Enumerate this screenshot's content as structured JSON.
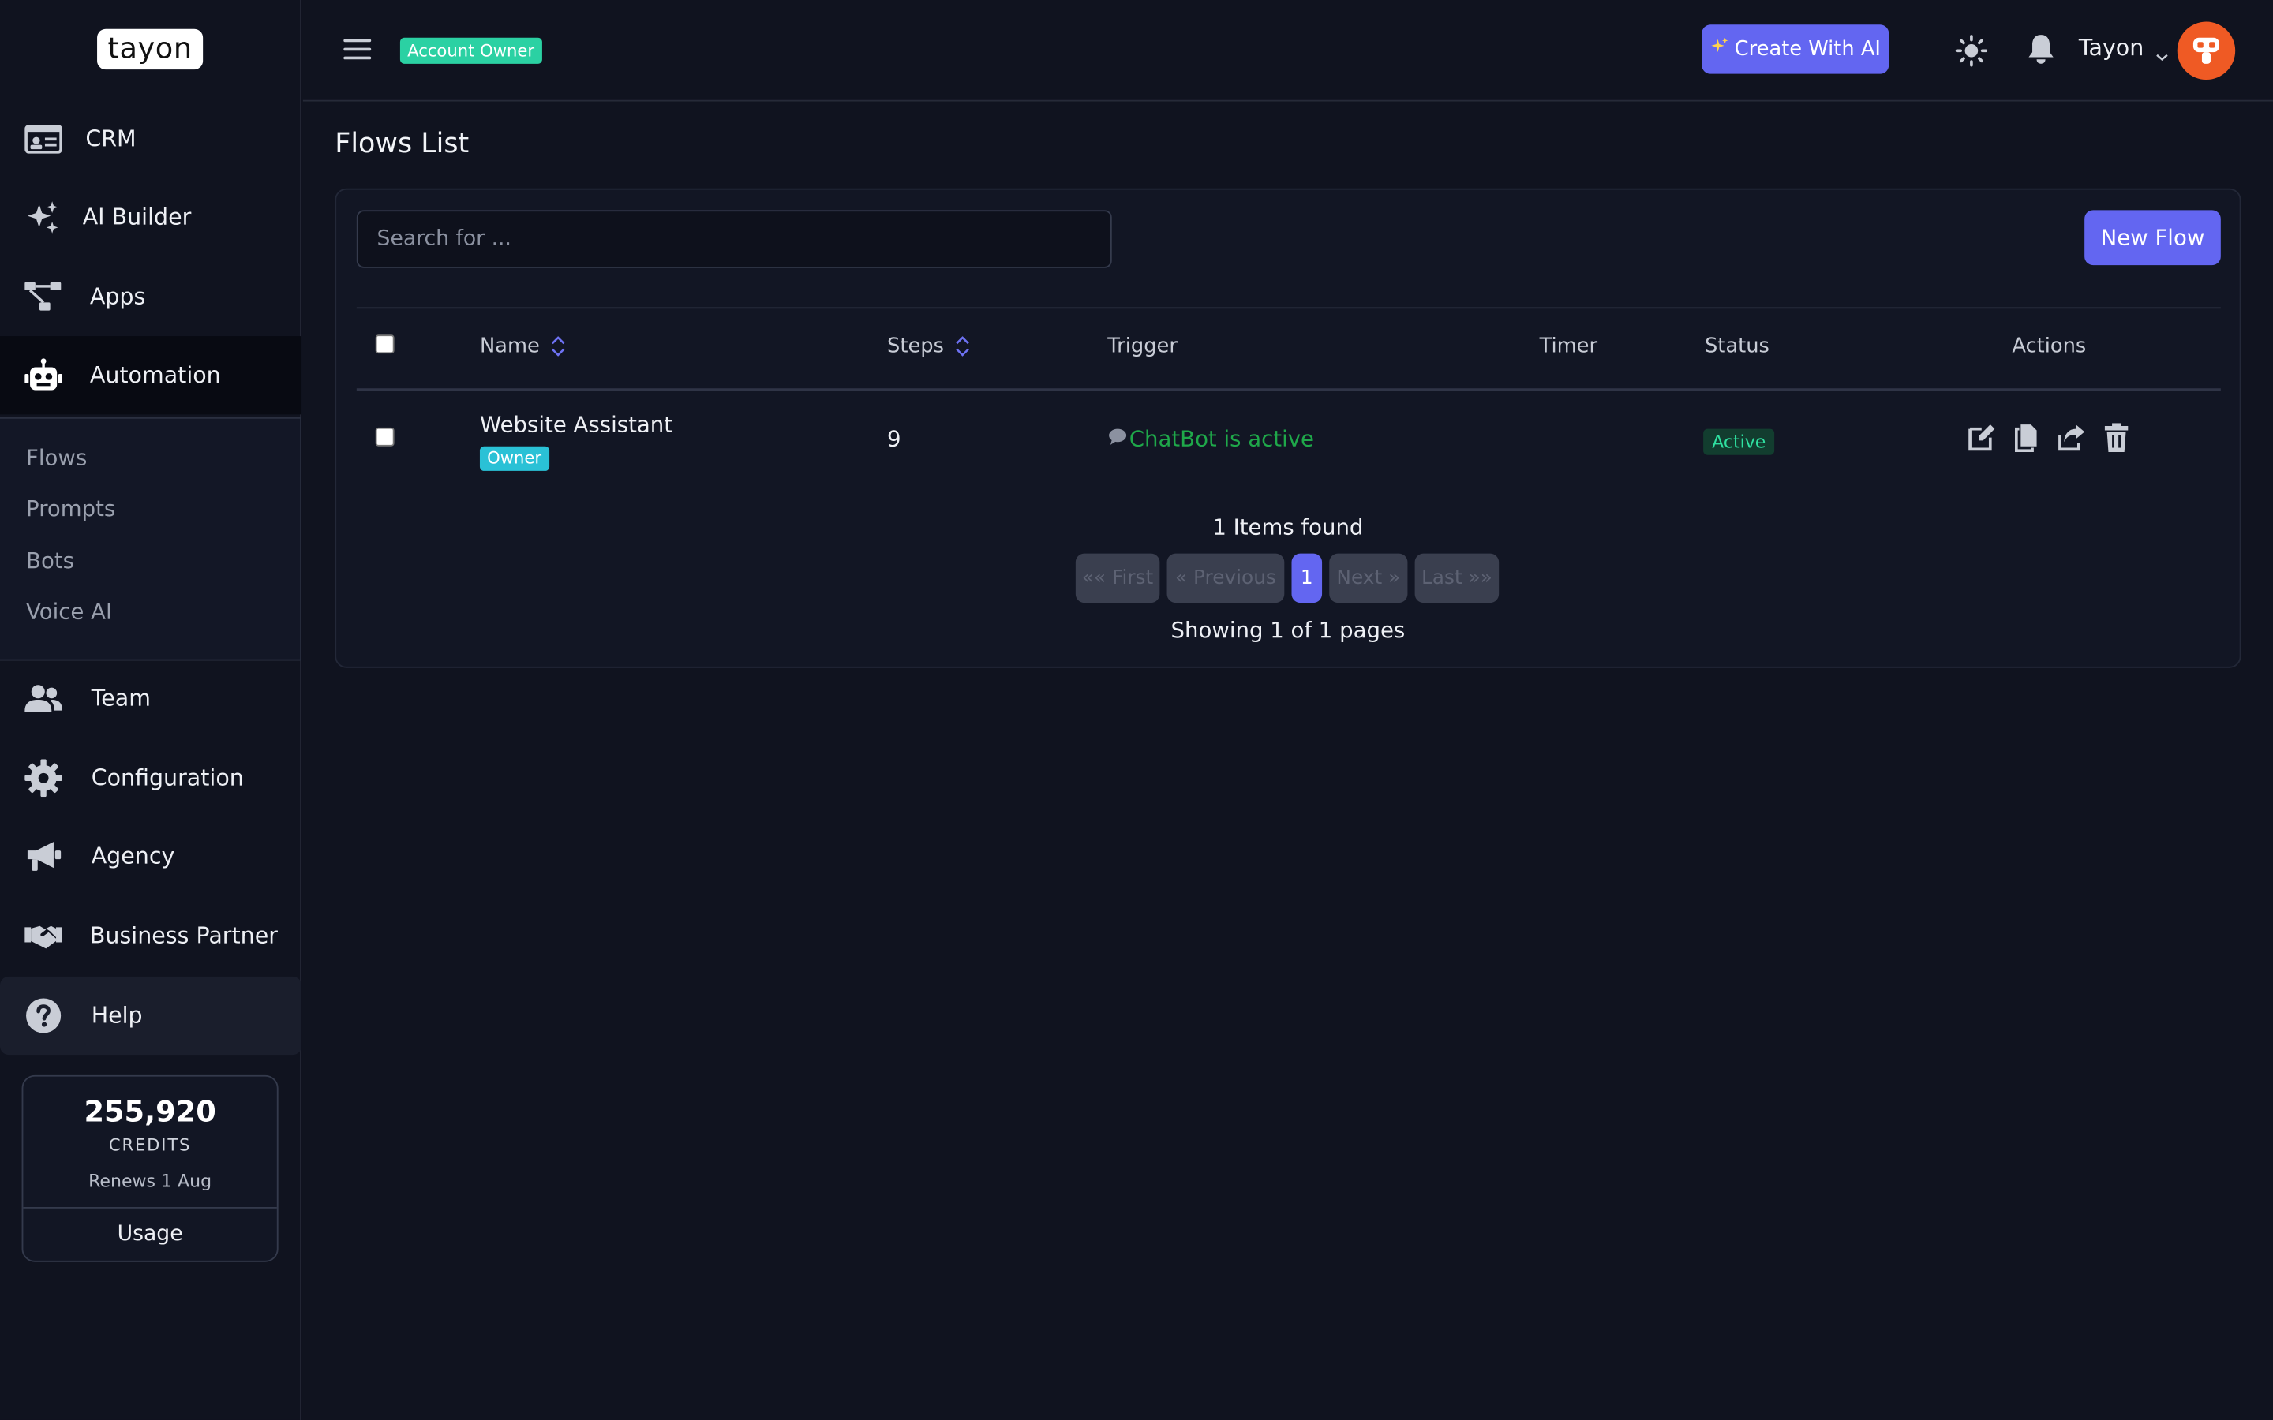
{
  "brand": {
    "logo_text": "tayon"
  },
  "sidebar": {
    "items": [
      {
        "label": "CRM",
        "icon": "id-card-icon"
      },
      {
        "label": "AI Builder",
        "icon": "sparkles-icon"
      },
      {
        "label": "Apps",
        "icon": "sitemap-icon"
      },
      {
        "label": "Automation",
        "icon": "robot-icon",
        "active": true
      },
      {
        "label": "Team",
        "icon": "users-icon"
      },
      {
        "label": "Configuration",
        "icon": "gear-icon"
      },
      {
        "label": "Agency",
        "icon": "megaphone-icon"
      },
      {
        "label": "Business Partner",
        "icon": "handshake-icon"
      },
      {
        "label": "Help",
        "icon": "question-circle-icon"
      }
    ],
    "submenu": [
      "Flows",
      "Prompts",
      "Bots",
      "Voice AI"
    ]
  },
  "credits": {
    "amount": "255,920",
    "label": "CREDITS",
    "renews": "Renews 1 Aug",
    "usage_label": "Usage"
  },
  "header": {
    "role_badge": "Account Owner",
    "create_ai_label": "Create With AI",
    "user_name": "Tayon"
  },
  "page": {
    "title": "Flows List",
    "search_placeholder": "Search for ...",
    "new_flow_label": "New Flow"
  },
  "table": {
    "columns": [
      "Name",
      "Steps",
      "Trigger",
      "Timer",
      "Status",
      "Actions"
    ],
    "rows": [
      {
        "name": "Website Assistant",
        "tag": "Owner",
        "steps": "9",
        "trigger": "ChatBot is active",
        "timer": "",
        "status": "Active"
      }
    ]
  },
  "pagination": {
    "found": "1 Items found",
    "first": "«« First",
    "previous": "« Previous",
    "current": "1",
    "next": "Next »",
    "last": "Last »»",
    "showing": "Showing 1 of 1 pages"
  },
  "colors": {
    "accent": "#6366f1",
    "background": "#10131f",
    "success": "#2fe0a0",
    "trigger": "#1fa84a",
    "avatar": "#ef5a24"
  }
}
